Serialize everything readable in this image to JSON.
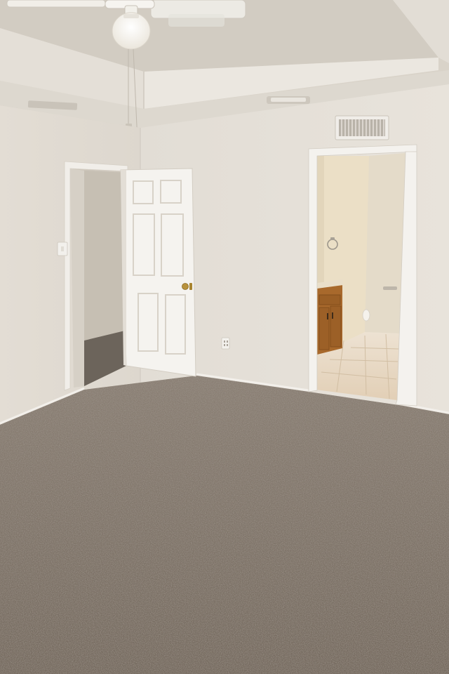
{
  "photo": {
    "subject": "empty-bedroom",
    "colors": {
      "wall": "#e6e1d9",
      "ceiling": "#ddd7cd",
      "trim": "#f4f2ee",
      "carpet": "#7d7166",
      "tile": "#e8d9c3",
      "cabinet": "#a8692c"
    },
    "icons": [
      "ceiling-fan-icon",
      "light-globe-icon",
      "air-vent-icon",
      "door-knob-icon",
      "light-switch-icon",
      "power-outlet-icon",
      "towel-ring-icon"
    ]
  }
}
